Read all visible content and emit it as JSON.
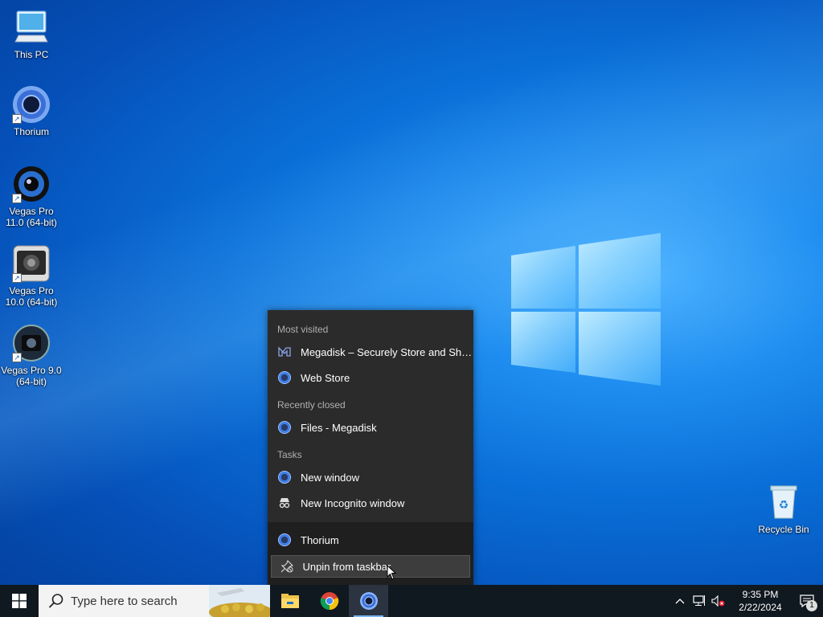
{
  "desktop_icons": [
    {
      "name": "desk-icon-this-pc",
      "label": "This PC",
      "icon": "computer-icon",
      "shortcut": false
    },
    {
      "name": "desk-icon-thorium",
      "label": "Thorium",
      "icon": "thorium-icon",
      "shortcut": true
    },
    {
      "name": "desk-icon-vegas-11",
      "label": "Vegas Pro 11.0 (64-bit)",
      "icon": "vegas-pro-icon",
      "shortcut": true
    },
    {
      "name": "desk-icon-vegas-10",
      "label": "Vegas Pro 10.0 (64-bit)",
      "icon": "vegas-pro-icon",
      "shortcut": true
    },
    {
      "name": "desk-icon-vegas-9",
      "label": "Vegas Pro 9.0 (64-bit)",
      "icon": "vegas-pro-icon",
      "shortcut": true
    },
    {
      "name": "desk-icon-recycle-bin",
      "label": "Recycle Bin",
      "icon": "recycle-bin-icon",
      "shortcut": false
    }
  ],
  "jumplist": {
    "most_visited_header": "Most visited",
    "most_visited": [
      {
        "label": "Megadisk – Securely Store and Share y...",
        "icon": "megadisk-icon"
      },
      {
        "label": "Web Store",
        "icon": "thorium-icon"
      }
    ],
    "recently_closed_header": "Recently closed",
    "recently_closed": [
      {
        "label": "Files - Megadisk",
        "icon": "thorium-icon"
      }
    ],
    "tasks_header": "Tasks",
    "tasks": [
      {
        "label": "New window",
        "icon": "thorium-icon"
      },
      {
        "label": "New Incognito window",
        "icon": "incognito-icon"
      }
    ],
    "app_label": "Thorium",
    "unpin_label": "Unpin from taskbar"
  },
  "taskbar": {
    "search_placeholder": "Type here to search",
    "apps": [
      "file-explorer-icon",
      "chrome-icon",
      "thorium-icon"
    ],
    "time": "9:35 PM",
    "date": "2/22/2024",
    "notification_count": "1"
  },
  "colors": {
    "jumplist_bg": "#2b2b2b",
    "taskbar_bg": "#101820",
    "accent": "#7ab4ef"
  }
}
